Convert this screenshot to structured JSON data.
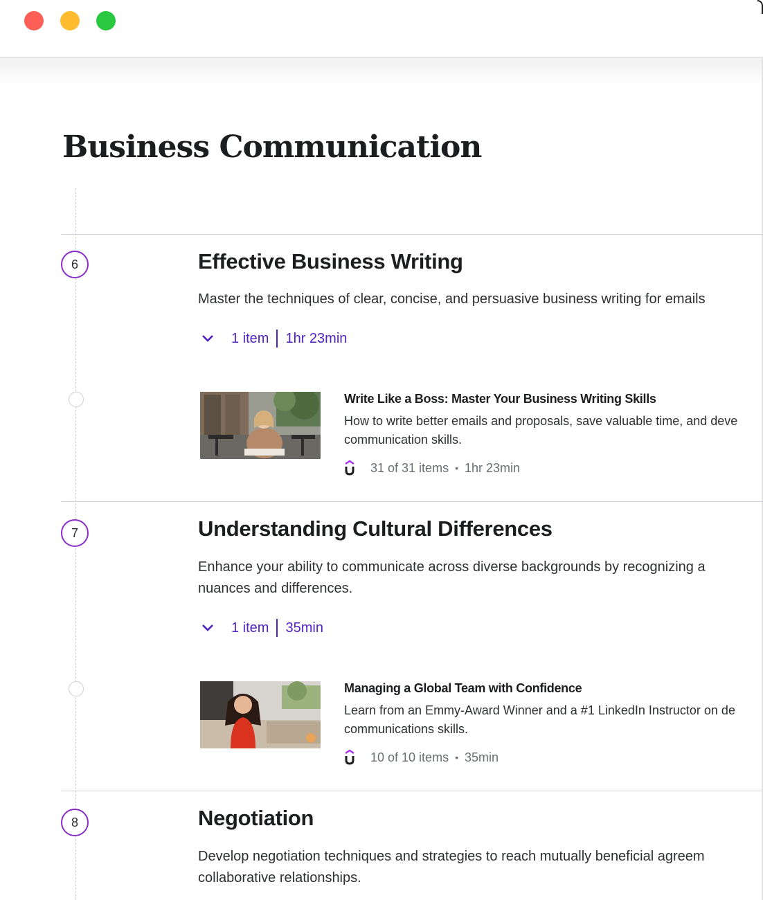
{
  "window": {
    "controls": [
      "close",
      "minimize",
      "zoom"
    ]
  },
  "page": {
    "title": "Business Communication"
  },
  "sections": [
    {
      "number": "6",
      "title": "Effective Business Writing",
      "description_lines": [
        "Master the techniques of clear, concise, and persuasive business writing for emails"
      ],
      "item_count": "1 item",
      "duration": "1hr 23min",
      "course": {
        "title": "Write Like a Boss: Master Your Business Writing Skills",
        "description_lines": [
          "How to write better emails and proposals, save valuable time, and deve",
          "communication skills."
        ],
        "items": "31 of 31 items",
        "duration": "1hr 23min",
        "thumbnail_icon": "woman-writing-at-cafe-photo"
      }
    },
    {
      "number": "7",
      "title": "Understanding Cultural Differences",
      "description_lines": [
        "Enhance your ability to communicate across diverse backgrounds by recognizing a",
        "nuances and differences."
      ],
      "item_count": "1 item",
      "duration": "35min",
      "course": {
        "title": "Managing a Global Team with Confidence",
        "description_lines": [
          "Learn from an Emmy-Award Winner and a #1 LinkedIn Instructor on de",
          "communications skills."
        ],
        "items": "10 of 10 items",
        "duration": "35min",
        "thumbnail_icon": "woman-in-red-dress-photo"
      }
    },
    {
      "number": "8",
      "title": "Negotiation",
      "description_lines": [
        "Develop negotiation techniques and strategies to reach mutually beneficial agreem",
        "collaborative relationships."
      ]
    }
  ],
  "colors": {
    "accent": "#5022c3",
    "step_ring": "#8b2dc8",
    "brand": "#a435f0"
  },
  "bullet": "•"
}
